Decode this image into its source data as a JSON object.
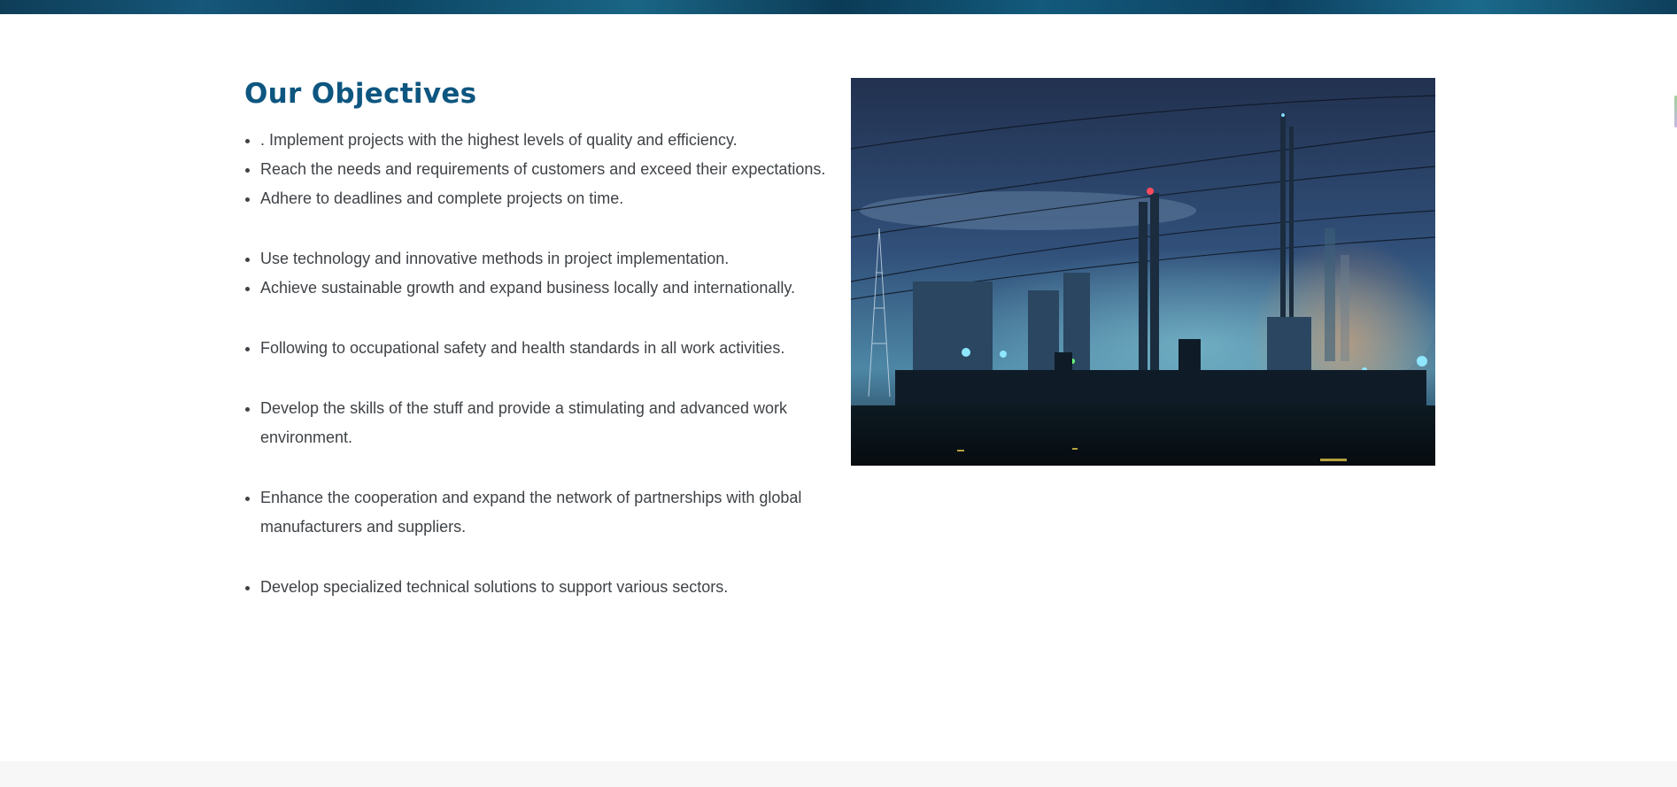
{
  "objectives": {
    "title": "Our Objectives",
    "items": [
      ". Implement projects with the highest levels of quality and efficiency.",
      "Reach the needs and requirements of customers and exceed their expectations.",
      "Adhere to deadlines and complete projects on time.",
      "Use technology and innovative methods in project implementation.",
      "Achieve sustainable growth and expand business locally and internationally.",
      "Following to occupational safety and health standards in all work activities.",
      "Develop the skills of the stuff and provide a stimulating and advanced work environment.",
      "Enhance the cooperation and expand the network of partnerships with global manufacturers and suppliers.",
      "Develop specialized technical solutions to support various sectors."
    ]
  },
  "colors": {
    "title": "#0d5680",
    "body_text": "#3f4347",
    "banner": "#0e3d57",
    "footer_band": "#f7f7f7"
  },
  "image": {
    "subject": "industrial plant at night"
  }
}
